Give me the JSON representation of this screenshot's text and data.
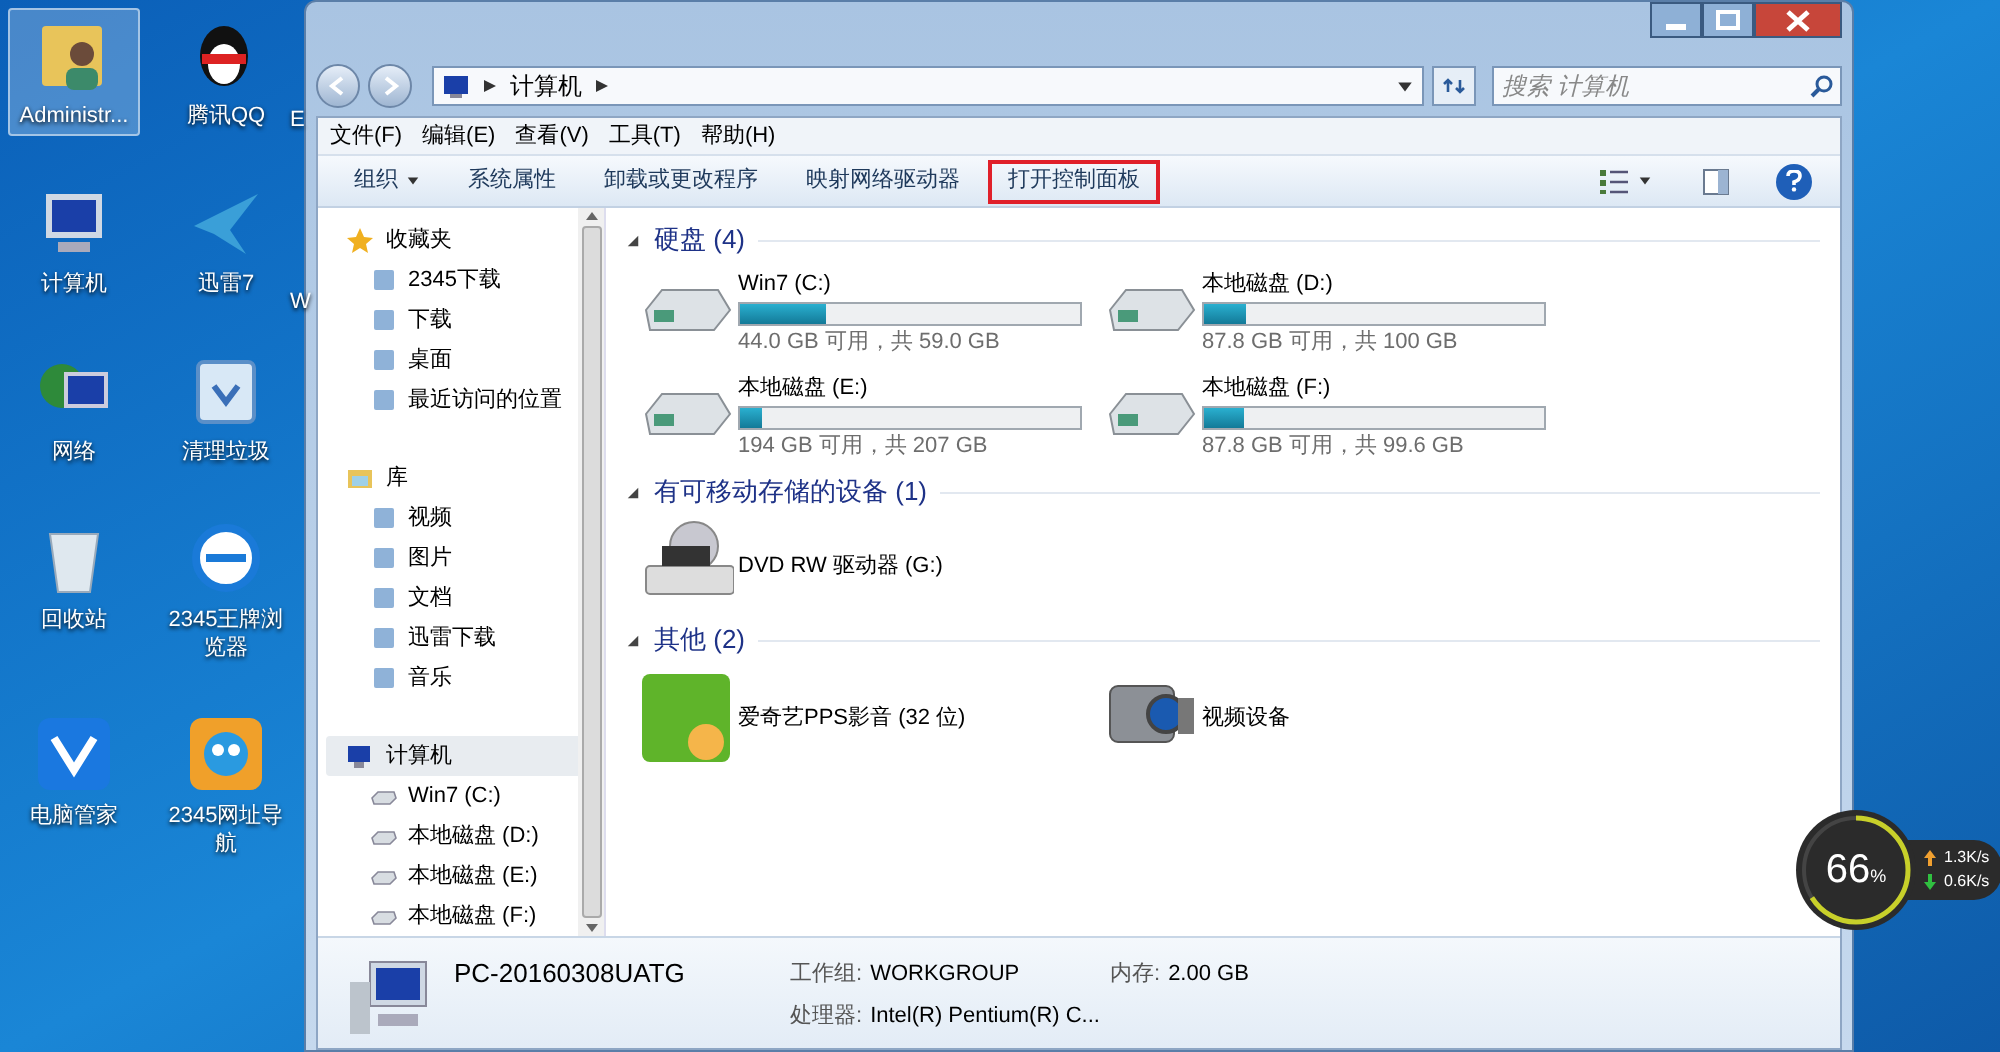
{
  "desktop": {
    "icons": [
      {
        "label": "Administr...",
        "selected": true
      },
      {
        "label": "腾讯QQ",
        "selected": false
      },
      {
        "label": "计算机",
        "selected": false
      },
      {
        "label": "迅雷7",
        "selected": false
      },
      {
        "label": "网络",
        "selected": false
      },
      {
        "label": "清理垃圾",
        "selected": false
      },
      {
        "label": "回收站",
        "selected": false
      },
      {
        "label": "2345王牌浏览器",
        "selected": false
      },
      {
        "label": "电脑管家",
        "selected": false
      },
      {
        "label": "2345网址导航",
        "selected": false
      }
    ],
    "partial_labels": [
      "E",
      "W"
    ]
  },
  "window": {
    "address": {
      "path": "计算机"
    },
    "search": {
      "placeholder": "搜索 计算机"
    },
    "menu": [
      "文件(F)",
      "编辑(E)",
      "查看(V)",
      "工具(T)",
      "帮助(H)"
    ],
    "toolbar": [
      {
        "label": "组织",
        "dropdown": true,
        "highlighted": false
      },
      {
        "label": "系统属性",
        "dropdown": false,
        "highlighted": false
      },
      {
        "label": "卸载或更改程序",
        "dropdown": false,
        "highlighted": false
      },
      {
        "label": "映射网络驱动器",
        "dropdown": false,
        "highlighted": false
      },
      {
        "label": "打开控制面板",
        "dropdown": false,
        "highlighted": true
      }
    ],
    "nav": [
      {
        "label": "收藏夹",
        "selected": false,
        "children": [
          {
            "label": "2345下载",
            "selected": false
          },
          {
            "label": "下载",
            "selected": false
          },
          {
            "label": "桌面",
            "selected": false
          },
          {
            "label": "最近访问的位置",
            "selected": false
          }
        ]
      },
      {
        "label": "库",
        "selected": false,
        "children": [
          {
            "label": "视频",
            "selected": false
          },
          {
            "label": "图片",
            "selected": false
          },
          {
            "label": "文档",
            "selected": false
          },
          {
            "label": "迅雷下载",
            "selected": false
          },
          {
            "label": "音乐",
            "selected": false
          }
        ]
      },
      {
        "label": "计算机",
        "selected": true,
        "children": [
          {
            "label": "Win7 (C:)",
            "selected": false
          },
          {
            "label": "本地磁盘 (D:)",
            "selected": false
          },
          {
            "label": "本地磁盘 (E:)",
            "selected": false
          },
          {
            "label": "本地磁盘 (F:)",
            "selected": false
          }
        ]
      }
    ],
    "groups": [
      {
        "title": "硬盘 (4)",
        "expanded": true,
        "items": [
          {
            "kind": "disk",
            "name": "Win7 (C:)",
            "level": 0.254,
            "info": "44.0 GB 可用，共 59.0 GB"
          },
          {
            "kind": "disk",
            "name": "本地磁盘 (D:)",
            "level": 0.122,
            "info": "87.8 GB 可用，共 100 GB"
          },
          {
            "kind": "disk",
            "name": "本地磁盘 (E:)",
            "level": 0.063,
            "info": "194 GB 可用，共 207 GB"
          },
          {
            "kind": "disk",
            "name": "本地磁盘 (F:)",
            "level": 0.118,
            "info": "87.8 GB 可用，共 99.6 GB"
          }
        ]
      },
      {
        "title": "有可移动存储的设备 (1)",
        "expanded": true,
        "items": [
          {
            "kind": "dvd",
            "name": "DVD RW 驱动器 (G:)"
          }
        ]
      },
      {
        "title": "其他 (2)",
        "expanded": true,
        "items": [
          {
            "kind": "app",
            "name": "爱奇艺PPS影音 (32 位)"
          },
          {
            "kind": "camera",
            "name": "视频设备"
          }
        ]
      }
    ],
    "details": {
      "computer_name": "PC-20160308UATG",
      "fields": [
        {
          "label": "工作组:",
          "value": "WORKGROUP"
        },
        {
          "label": "内存:",
          "value": "2.00 GB"
        },
        {
          "label": "处理器:",
          "value": "Intel(R) Pentium(R) C..."
        }
      ]
    }
  },
  "net_widget": {
    "percent": "66",
    "unit": "%",
    "level": 0.66,
    "upload": "1.3K/s",
    "download": "0.6K/s"
  }
}
